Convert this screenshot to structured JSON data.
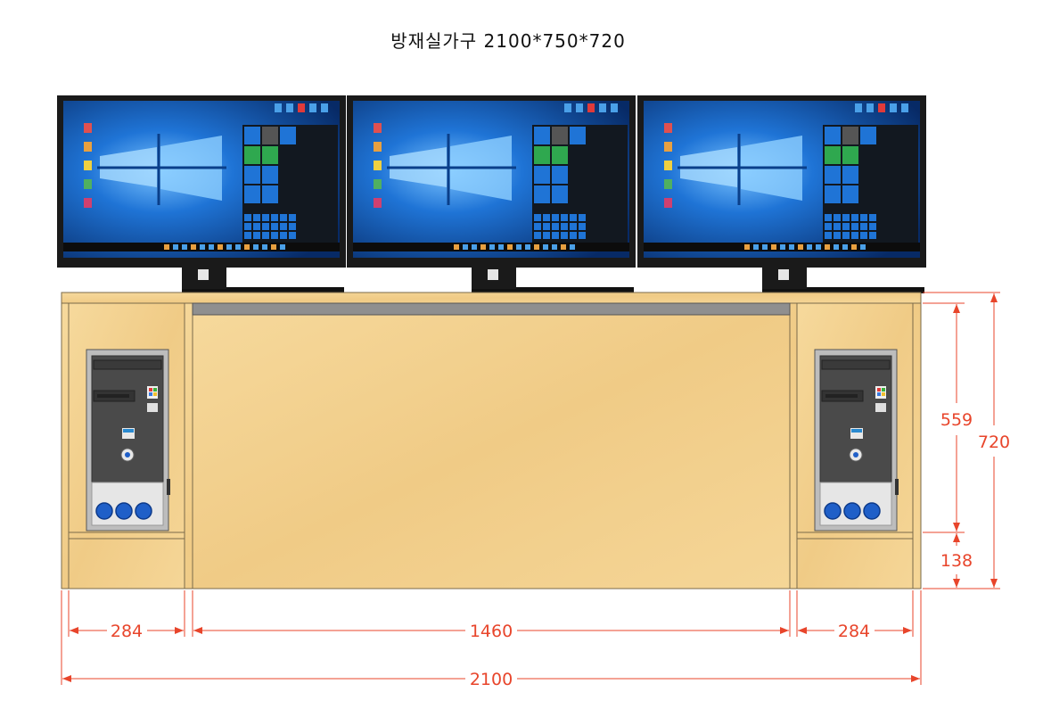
{
  "title": "방재실가구 2100*750*720",
  "dimensions": {
    "left_cabinet_width": "284",
    "center_width": "1460",
    "right_cabinet_width": "284",
    "total_width": "2100",
    "upper_height": "559",
    "lower_height": "138",
    "total_height": "720"
  },
  "colors": {
    "wood": "#f2cf8c",
    "dimension": "#e8452b",
    "monitor_bezel": "#1a1a1a",
    "screen_blue": "#1f6fd0",
    "pc_case": "#4a4a4a",
    "pc_front": "#e6e6e6",
    "pc_button": "#1f5fc8"
  },
  "monitors": [
    {
      "name": "monitor-left"
    },
    {
      "name": "monitor-center"
    },
    {
      "name": "monitor-right"
    }
  ]
}
